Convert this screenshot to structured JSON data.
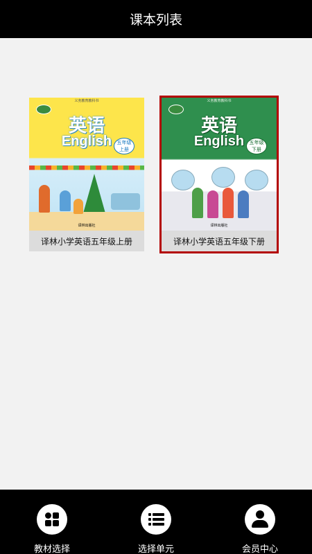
{
  "header": {
    "title": "课本列表"
  },
  "books": [
    {
      "title": "译林小学英语五年级上册",
      "cover": {
        "series": "义务教育教科书",
        "subject_zh": "英语",
        "subject_en": "English",
        "grade": "五年级 上册",
        "publisher": "译林出版社"
      },
      "selected": false
    },
    {
      "title": "译林小学英语五年级下册",
      "cover": {
        "series": "义务教育教科书",
        "subject_zh": "英语",
        "subject_en": "English",
        "grade": "五年级 下册",
        "publisher": "译林出版社"
      },
      "selected": true
    }
  ],
  "bottom_nav": [
    {
      "label": "教材选择",
      "icon": "grid-icon"
    },
    {
      "label": "选择单元",
      "icon": "list-icon"
    },
    {
      "label": "会员中心",
      "icon": "user-icon"
    }
  ],
  "colors": {
    "header_bg": "#000000",
    "nav_bg": "#000000",
    "selected_border": "#b30000",
    "page_bg": "#f2f2f2"
  }
}
